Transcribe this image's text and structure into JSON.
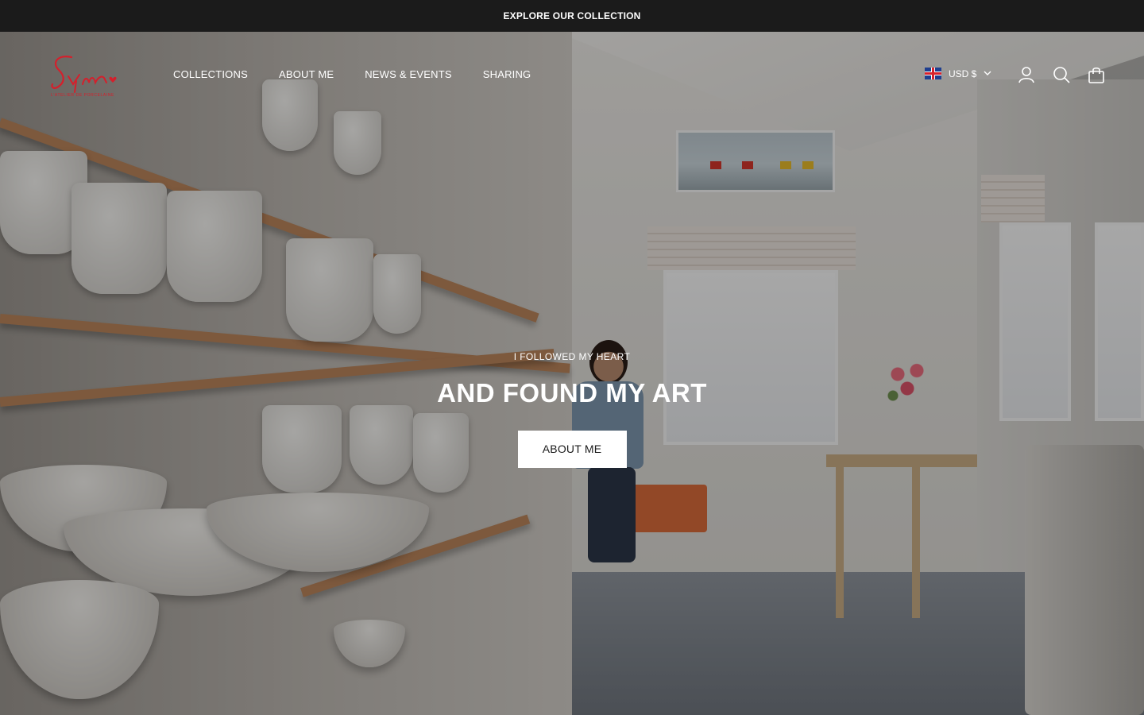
{
  "announcement": {
    "text": "EXPLORE OUR COLLECTION"
  },
  "header": {
    "logo_alt": "Syma L'Atelier de Porcelaine",
    "nav": [
      {
        "label": "COLLECTIONS"
      },
      {
        "label": "ABOUT ME"
      },
      {
        "label": "NEWS & EVENTS"
      },
      {
        "label": "SHARING"
      }
    ],
    "currency": {
      "label": "USD $",
      "flag": "uk-flag-icon"
    },
    "icons": [
      "account-icon",
      "search-icon",
      "cart-icon"
    ]
  },
  "hero": {
    "kicker": "I FOLLOWED MY HEART",
    "headline": "AND FOUND MY ART",
    "cta_label": "ABOUT ME"
  },
  "colors": {
    "announcement_bg": "#1b1b1b",
    "logo": "#d4202c",
    "cta_bg": "#ffffff",
    "cta_text": "#1b1b1b"
  }
}
